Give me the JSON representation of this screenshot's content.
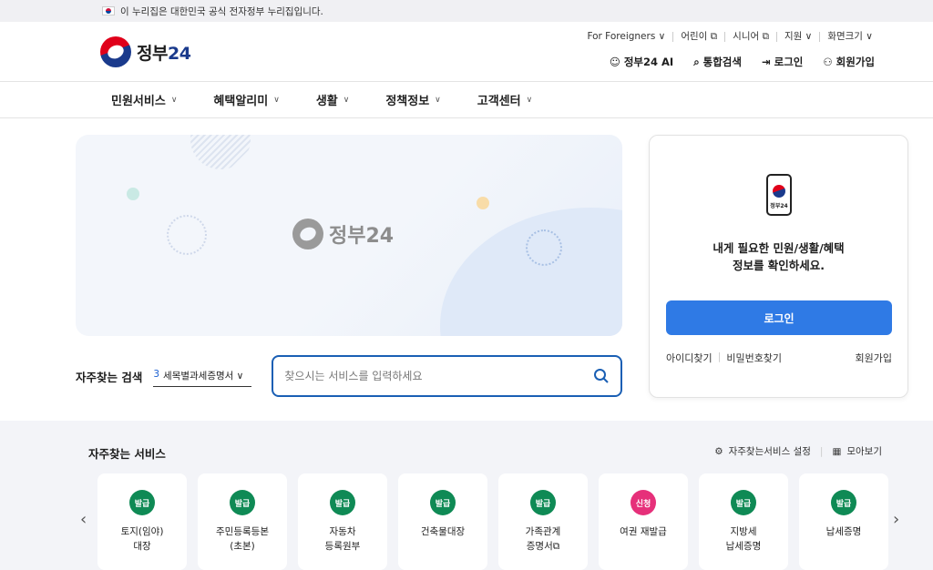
{
  "topbar": {
    "text": "이 누리집은 대한민국 공식 전자정부 누리집입니다."
  },
  "logo": {
    "text": "정부",
    "num": "24"
  },
  "util": [
    {
      "label": "For Foreigners ∨"
    },
    {
      "label": "어린이 ⧉"
    },
    {
      "label": "시니어 ⧉"
    },
    {
      "label": "지원 ∨"
    },
    {
      "label": "화면크기 ∨"
    }
  ],
  "main_links": [
    {
      "label": "정부24 AI"
    },
    {
      "label": "통합검색"
    },
    {
      "label": "로그인"
    },
    {
      "label": "회원가입"
    }
  ],
  "nav": [
    {
      "label": "민원서비스"
    },
    {
      "label": "혜택알리미"
    },
    {
      "label": "생활"
    },
    {
      "label": "정책정보"
    },
    {
      "label": "고객센터"
    }
  ],
  "hero": {
    "logo_text": "정부24"
  },
  "search": {
    "label": "자주찾는 검색",
    "select_num": "3",
    "select_text": "세목별과세증명서 ∨",
    "placeholder": "찾으시는 서비스를 입력하세요"
  },
  "login_card": {
    "phone_text": "정부24",
    "message_line1": "내게 필요한 민원/생활/혜택",
    "message_line2": "정보를 확인하세요.",
    "login_button": "로그인",
    "find_id": "아이디찾기",
    "find_pw": "비밀번호찾기",
    "signup": "회원가입"
  },
  "favorites": {
    "title": "자주찾는 서비스",
    "settings": "자주찾는서비스 설정",
    "view_all": "모아보기",
    "items": [
      {
        "badge": "발급",
        "color": "green",
        "label": "토지(임야)\n대장"
      },
      {
        "badge": "발급",
        "color": "green",
        "label": "주민등록등본\n(초본)"
      },
      {
        "badge": "발급",
        "color": "green",
        "label": "자동차\n등록원부"
      },
      {
        "badge": "발급",
        "color": "green",
        "label": "건축물대장"
      },
      {
        "badge": "발급",
        "color": "green",
        "label": "가족관계\n증명서⧉"
      },
      {
        "badge": "신청",
        "color": "pink",
        "label": "여권 재발급"
      },
      {
        "badge": "발급",
        "color": "green",
        "label": "지방세\n납세증명"
      },
      {
        "badge": "발급",
        "color": "green",
        "label": "납세증명"
      }
    ]
  },
  "colors": {
    "primary": "#2f7ae5",
    "issue_badge": "#0f8a55",
    "apply_badge": "#e6307a"
  }
}
